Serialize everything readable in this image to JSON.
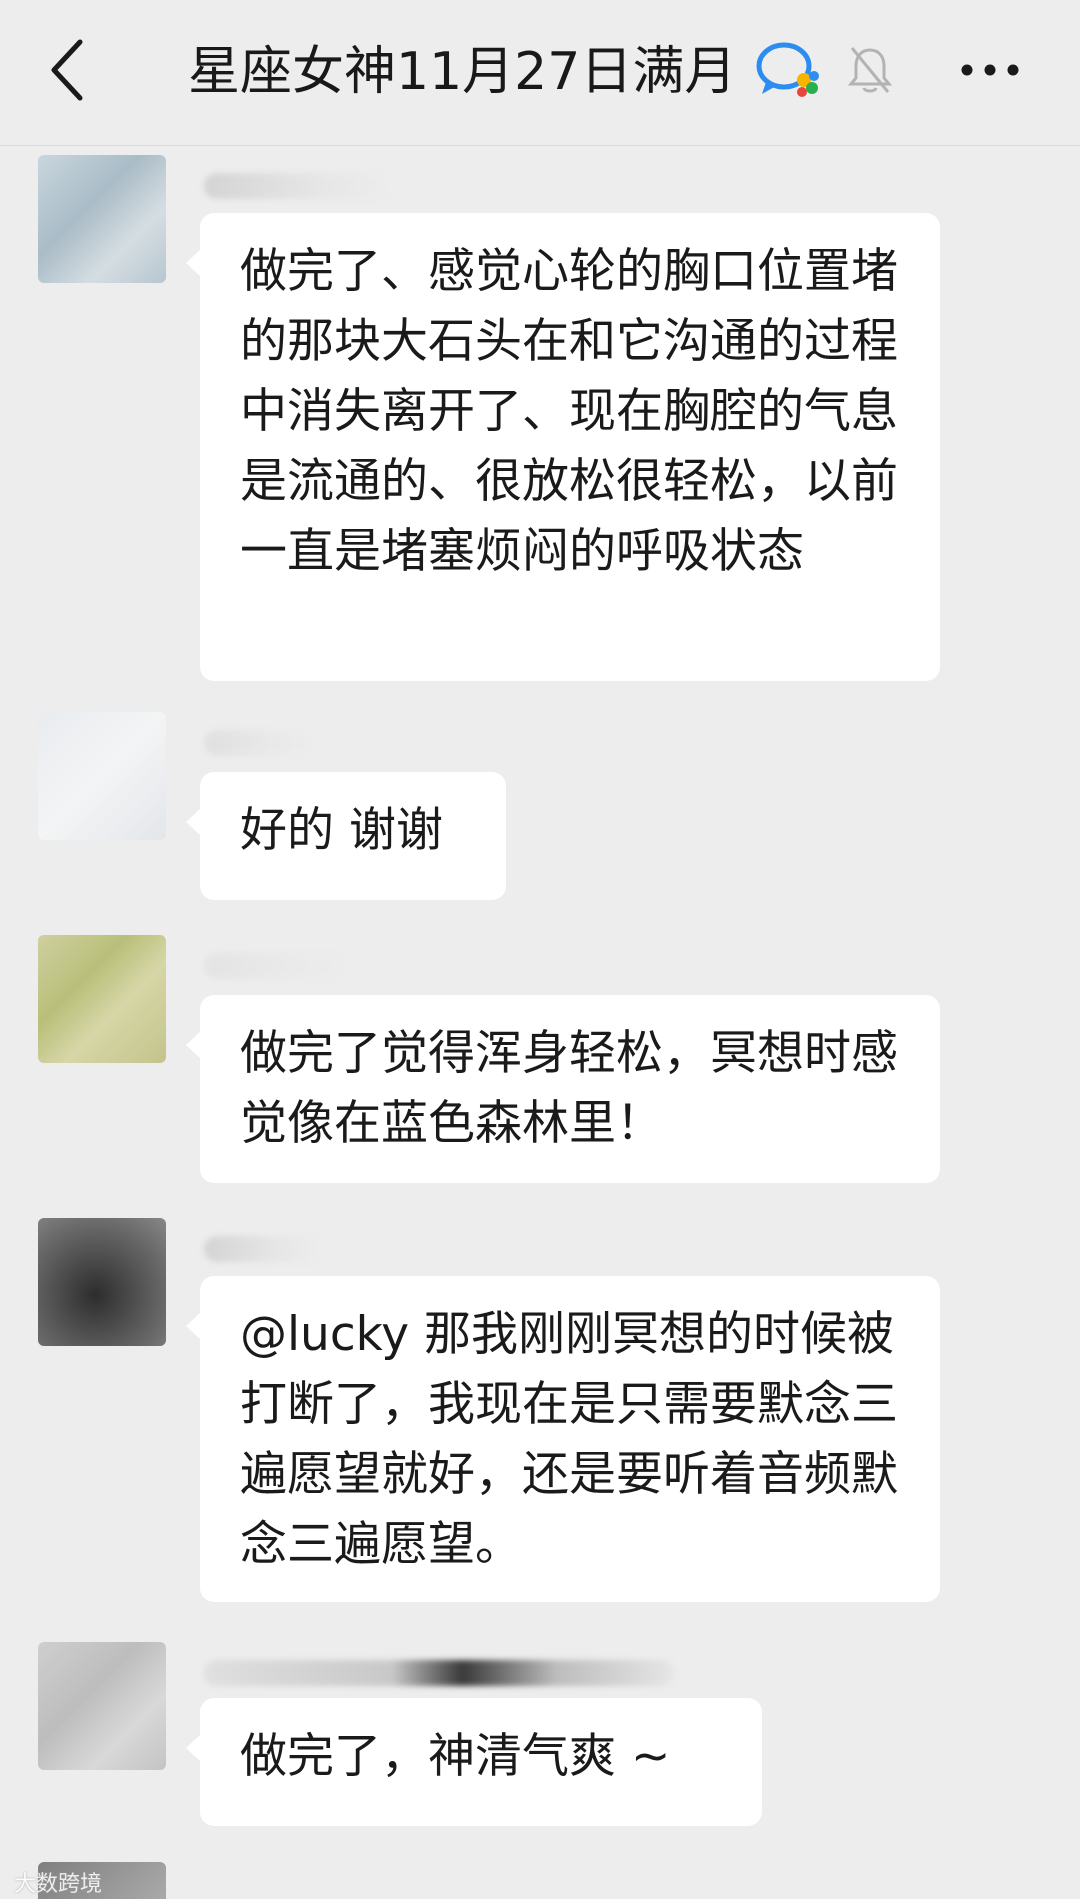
{
  "header": {
    "back_icon": "chevron-left-icon",
    "title": "星座女神11月27日满月",
    "chat_icon": "wecom-chat-icon",
    "mute_icon": "bell-mute-icon",
    "more_icon": "more-dots-icon"
  },
  "messages": [
    {
      "text": "做完了、感觉心轮的胸口位置堵的那块大石头在和它沟通的过程中消失离开了、现在胸腔的气息是流通的、很放松很轻松，以前一直是堵塞烦闷的呼吸状态"
    },
    {
      "text": "好的 谢谢"
    },
    {
      "text": "做完了觉得浑身轻松，冥想时感觉像在蓝色森林里！"
    },
    {
      "text": "@lucky 那我刚刚冥想的时候被打断了，我现在是只需要默念三遍愿望就好，还是要听着音频默念三遍愿望。"
    },
    {
      "text": "做完了，神清气爽 ~"
    }
  ],
  "watermark": "大数跨境"
}
